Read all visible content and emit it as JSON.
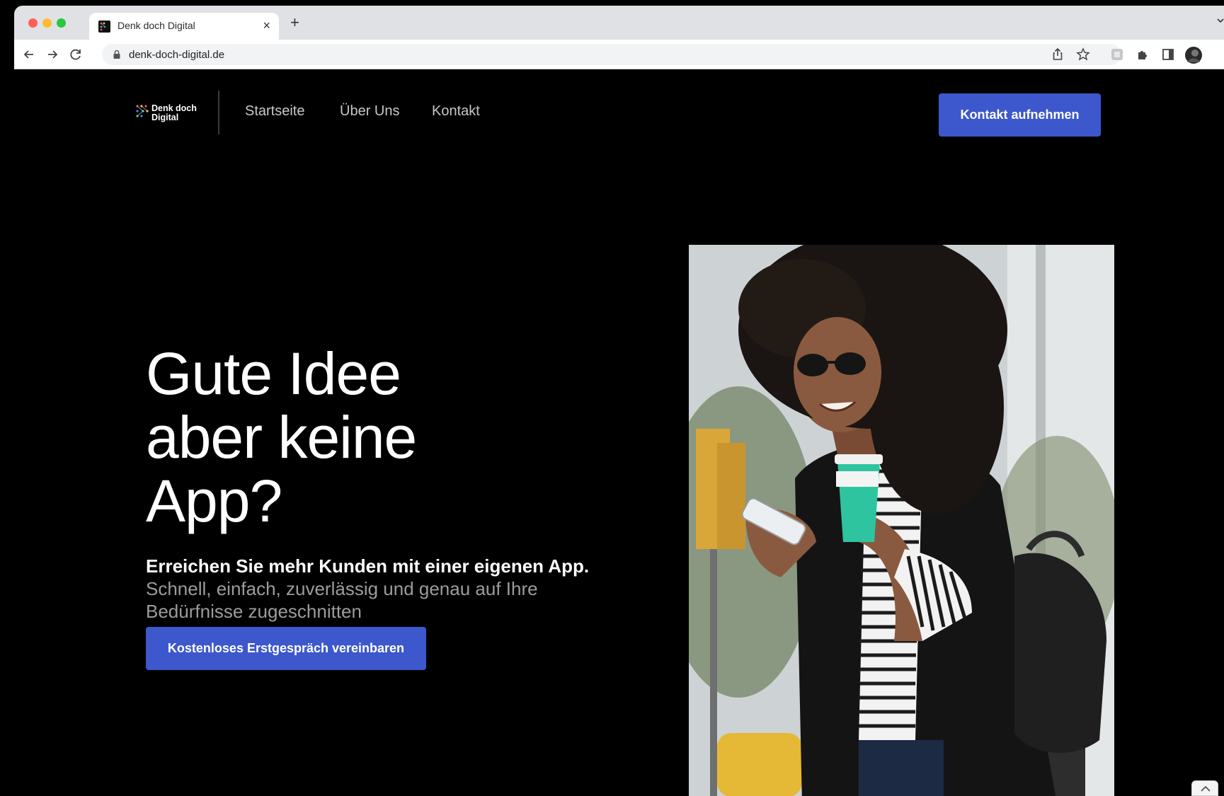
{
  "browser": {
    "tab_title": "Denk doch Digital",
    "tab_close": "×",
    "new_tab": "+",
    "url": "denk-doch-digital.de"
  },
  "colors": {
    "accent": "#3d57cc",
    "page_background": "#000000",
    "nav_text": "#c8c8c8",
    "muted_text": "#9c9c9c"
  },
  "header": {
    "logo_text": "Denk doch\nDigital",
    "nav": [
      {
        "label": "Startseite"
      },
      {
        "label": "Über Uns"
      },
      {
        "label": "Kontakt"
      }
    ],
    "cta_label": "Kontakt aufnehmen"
  },
  "hero": {
    "headline_lines": [
      "Gute Idee",
      "aber keine",
      "App?"
    ],
    "subtext_strong": "Erreichen Sie mehr Kunden mit einer eigenen App.",
    "subtext_muted": "Schnell, einfach, zuverlässig und genau auf Ihre Bedürfnisse zugeschnitten",
    "cta_label": "Kostenloses Erstgespräch vereinbaren",
    "image": "woman-with-phone-and-coffee-photo"
  },
  "icons": {
    "back": "arrow-left-icon",
    "forward": "arrow-right-icon",
    "reload": "reload-icon",
    "lock": "lock-icon",
    "share": "share-icon",
    "bookmark": "star-icon",
    "extensions": "puzzle-icon",
    "sidepanel": "side-panel-icon",
    "profile": "avatar"
  }
}
